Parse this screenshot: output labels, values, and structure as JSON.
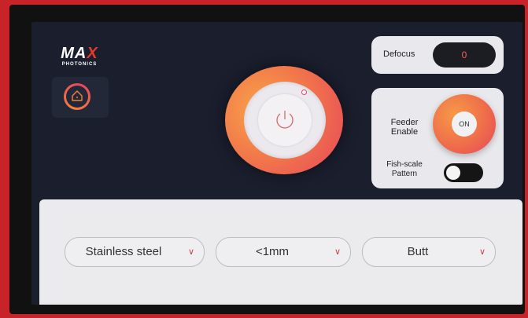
{
  "brand": {
    "name_part1": "MA",
    "name_accent": "X",
    "subtitle": "PHOTONICS"
  },
  "home": {
    "icon": "home-icon"
  },
  "power": {
    "icon": "power-icon"
  },
  "defocus": {
    "label": "Defocus",
    "value": "0"
  },
  "feeder": {
    "label_line1": "Feeder",
    "label_line2": "Enable",
    "state": "ON"
  },
  "fish_scale": {
    "label_line1": "Fish-scale",
    "label_line2": "Pattern",
    "enabled": false
  },
  "selects": {
    "material": {
      "value": "Stainless steel"
    },
    "thickness": {
      "value": "<1mm"
    },
    "joint": {
      "value": "Butt"
    }
  },
  "colors": {
    "accent": "#f0703f",
    "accent_red": "#e6455a",
    "screen_bg": "#1a1e2d"
  }
}
